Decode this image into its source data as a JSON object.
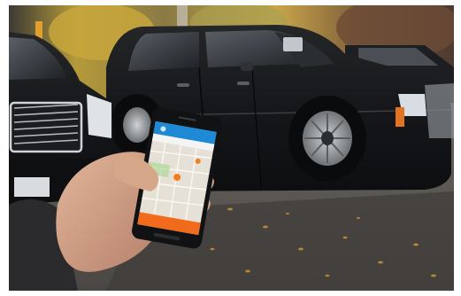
{
  "photo": {
    "scene": "street-parking-suvs",
    "phone_app": {
      "header_color": "#1e8ad6",
      "map_color": "#e6e1d6",
      "pin_color": "#f07d1e",
      "button_color": "#f26a1b",
      "button_label": ""
    }
  }
}
